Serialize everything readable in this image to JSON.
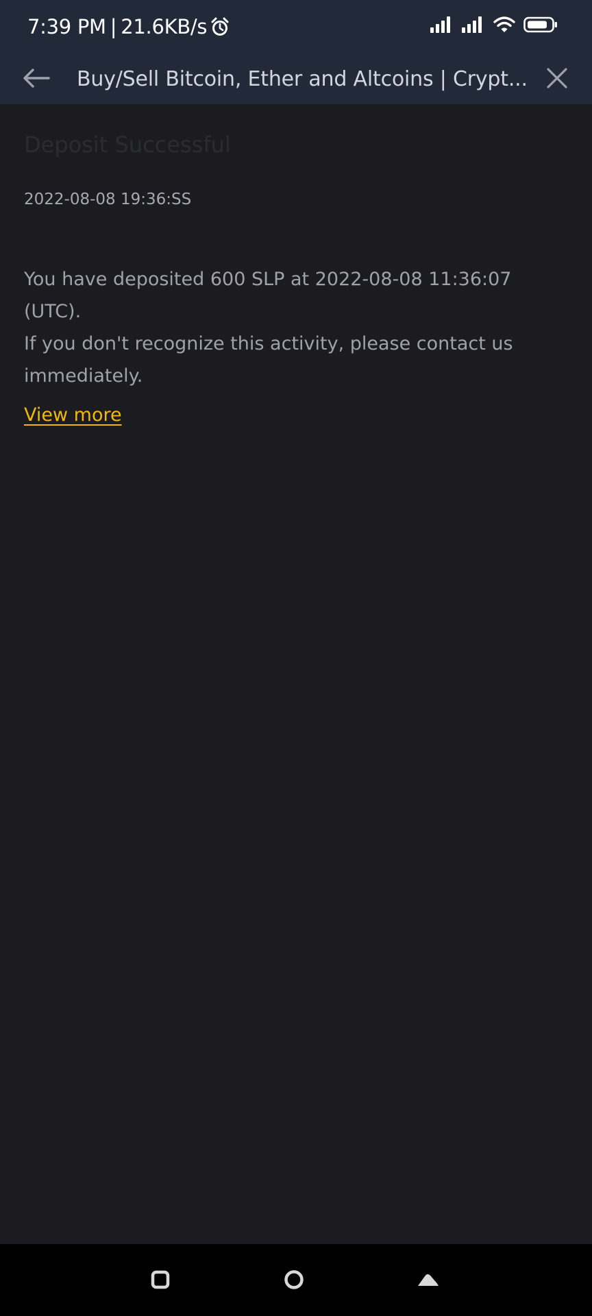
{
  "status_bar": {
    "time": "7:39 PM",
    "separator": "|",
    "network_speed": "21.6KB/s",
    "icons": [
      "alarm-icon",
      "signal-icon",
      "signal-icon",
      "wifi-icon",
      "battery-icon"
    ]
  },
  "toolbar": {
    "back_icon": "arrow-left-icon",
    "title": "Buy/Sell Bitcoin, Ether and Altcoins | Crypt...",
    "close_icon": "close-icon"
  },
  "message": {
    "title": "Deposit Successful",
    "timestamp": "2022-08-08 19:36:SS",
    "body_line1": "You have deposited 600 SLP at 2022-08-08 11:36:07 (UTC).",
    "body_line2": "If you don't recognize this activity, please contact us immediately.",
    "link": "View more"
  },
  "nav_bar": {
    "icons": [
      "recent-apps-icon",
      "home-icon",
      "back-icon"
    ]
  },
  "colors": {
    "bar": "#222938",
    "background": "#1c1c20",
    "link": "#f0b90b",
    "body_text": "#9ea2ab"
  }
}
